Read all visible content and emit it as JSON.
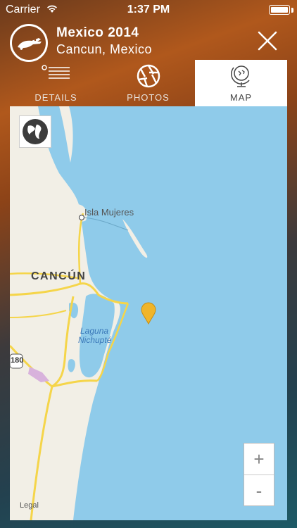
{
  "status_bar": {
    "carrier": "Carrier",
    "time": "1:37 PM"
  },
  "header": {
    "title": "Mexico 2014",
    "subtitle": "Cancun, Mexico"
  },
  "tabs": [
    {
      "label": "DETAILS",
      "icon": "list-icon",
      "active": false
    },
    {
      "label": "PHOTOS",
      "icon": "aperture-icon",
      "active": false
    },
    {
      "label": "MAP",
      "icon": "globe-stand-icon",
      "active": true
    }
  ],
  "map": {
    "labels": {
      "city": "CANCÚN",
      "island": "Isla Mujeres",
      "lagoon_line1": "Laguna",
      "lagoon_line2": "Nichupté",
      "route": "180"
    },
    "legal": "Legal",
    "zoom_in": "+",
    "zoom_out": "-",
    "colors": {
      "water": "#8fcbea",
      "land": "#f2efe6",
      "road": "#f5d54a",
      "pin": "#f0b52a"
    }
  }
}
